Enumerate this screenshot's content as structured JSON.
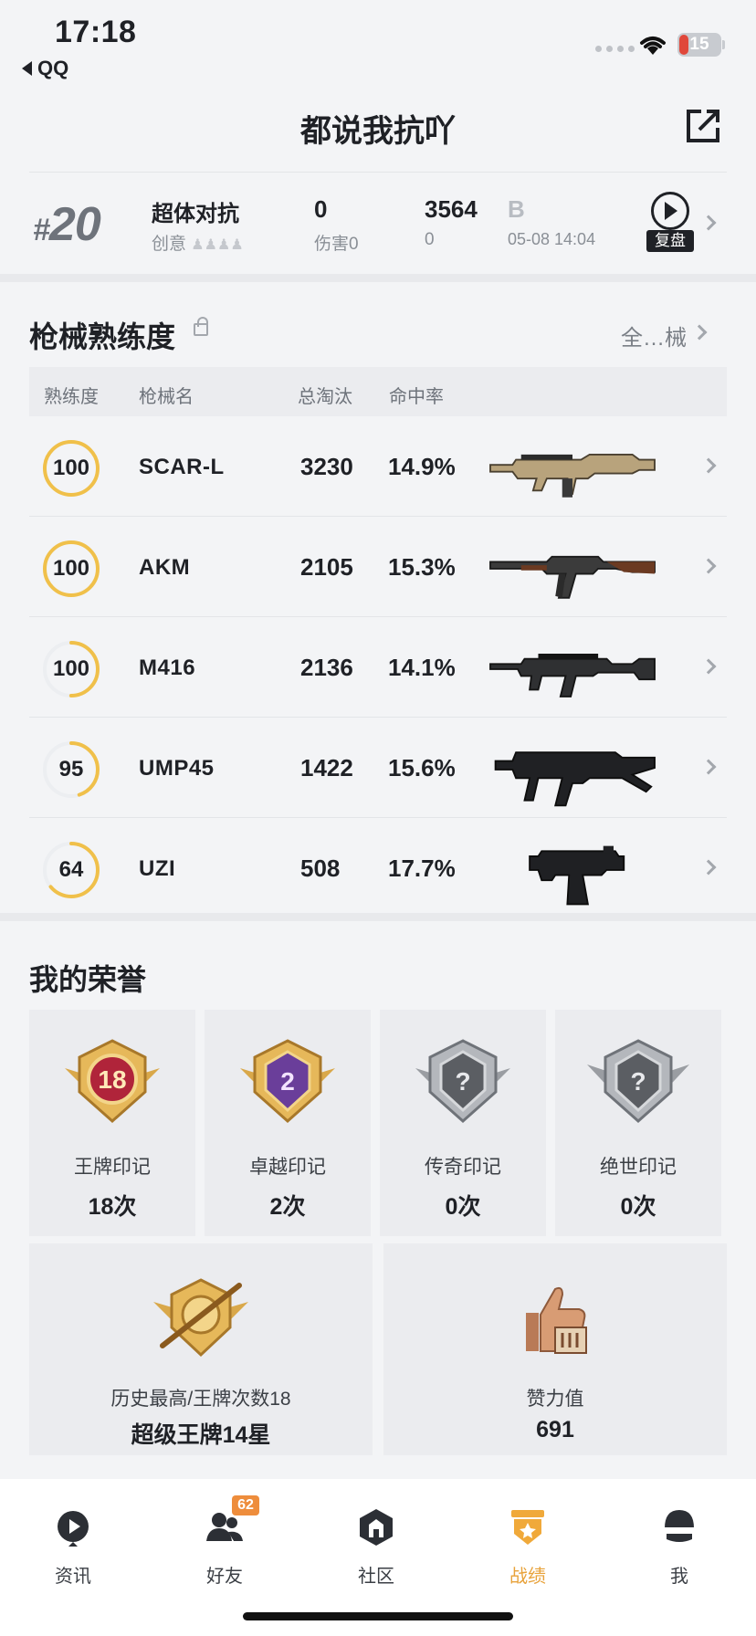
{
  "status_bar": {
    "time": "17:18",
    "back_app": "QQ",
    "battery": "15"
  },
  "header": {
    "title": "都说我抗吖"
  },
  "match": {
    "rank_prefix": "#",
    "rank": "20",
    "mode": "超体对抗",
    "mode_sub": "创意",
    "kills": "0",
    "damage_label": "伤害0",
    "score": "3564",
    "score_sub": "0",
    "tier_letter": "B",
    "datetime": "05-08 14:04",
    "replay_label": "复盘"
  },
  "weapons_section": {
    "title": "枪械熟练度",
    "all_link": "全…械",
    "headers": [
      "熟练度",
      "枪械名",
      "总淘汰",
      "命中率"
    ],
    "rows": [
      {
        "proficiency": "100",
        "name": "SCAR-L",
        "kills": "3230",
        "accuracy": "14.9%",
        "level": 1.0
      },
      {
        "proficiency": "100",
        "name": "AKM",
        "kills": "2105",
        "accuracy": "15.3%",
        "level": 1.0
      },
      {
        "proficiency": "100",
        "name": "M416",
        "kills": "2136",
        "accuracy": "14.1%",
        "level": 0.5
      },
      {
        "proficiency": "95",
        "name": "UMP45",
        "kills": "1422",
        "accuracy": "15.6%",
        "level": 0.45
      },
      {
        "proficiency": "64",
        "name": "UZI",
        "kills": "508",
        "accuracy": "17.7%",
        "level": 0.64
      }
    ]
  },
  "honors": {
    "title": "我的荣誉",
    "items": [
      {
        "label": "王牌印记",
        "count": "18次",
        "badge": "18"
      },
      {
        "label": "卓越印记",
        "count": "2次",
        "badge": "2"
      },
      {
        "label": "传奇印记",
        "count": "0次",
        "badge": "?"
      },
      {
        "label": "绝世印记",
        "count": "0次",
        "badge": "?"
      }
    ],
    "highest_label": "历史最高/王牌次数18",
    "highest_value": "超级王牌14星",
    "likes_label": "赞力值",
    "likes_value": "691"
  },
  "tabbar": {
    "tabs": [
      {
        "label": "资讯",
        "icon": "news-icon"
      },
      {
        "label": "好友",
        "icon": "friends-icon",
        "badge": "62"
      },
      {
        "label": "社区",
        "icon": "community-icon"
      },
      {
        "label": "战绩",
        "icon": "record-icon"
      },
      {
        "label": "我",
        "icon": "profile-icon"
      }
    ]
  },
  "colors": {
    "accent": "#e8a23a",
    "ring_track": "#eceef1",
    "gold": "#f0c04a"
  }
}
